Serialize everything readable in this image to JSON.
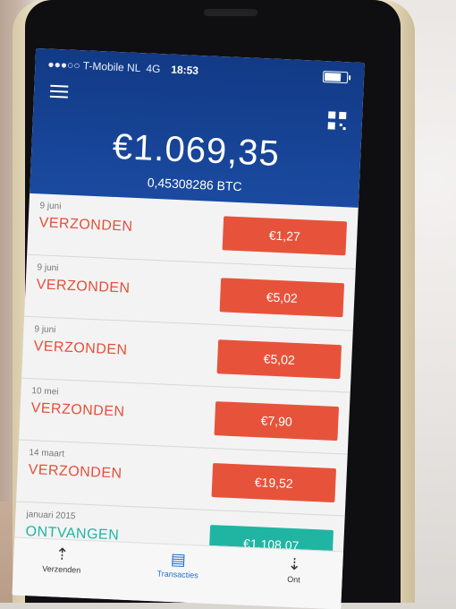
{
  "status_bar": {
    "carrier": "●●●○○ T-Mobile NL",
    "network": "4G",
    "time": "18:53"
  },
  "wallet": {
    "balance_eur": "€1.069,35",
    "balance_btc": "0,45308286 BTC"
  },
  "transactions": [
    {
      "date": "9 juni",
      "type": "VERZONDEN",
      "amount": "€1,27",
      "kind": "sent"
    },
    {
      "date": "9 juni",
      "type": "VERZONDEN",
      "amount": "€5,02",
      "kind": "sent"
    },
    {
      "date": "9 juni",
      "type": "VERZONDEN",
      "amount": "€5,02",
      "kind": "sent"
    },
    {
      "date": "10 mei",
      "type": "VERZONDEN",
      "amount": "€7,90",
      "kind": "sent"
    },
    {
      "date": "14 maart",
      "type": "VERZONDEN",
      "amount": "€19,52",
      "kind": "sent"
    },
    {
      "date": "januari 2015",
      "type": "ONTVANGEN",
      "amount": "€1.108,07",
      "kind": "recv"
    }
  ],
  "tabs": [
    {
      "label": "Verzenden",
      "icon": "upload-icon"
    },
    {
      "label": "Transacties",
      "icon": "list-icon"
    },
    {
      "label": "Ont",
      "icon": "download-icon"
    }
  ],
  "colors": {
    "header": "#1a4aa0",
    "sent": "#e7533a",
    "received": "#20b5a2"
  }
}
